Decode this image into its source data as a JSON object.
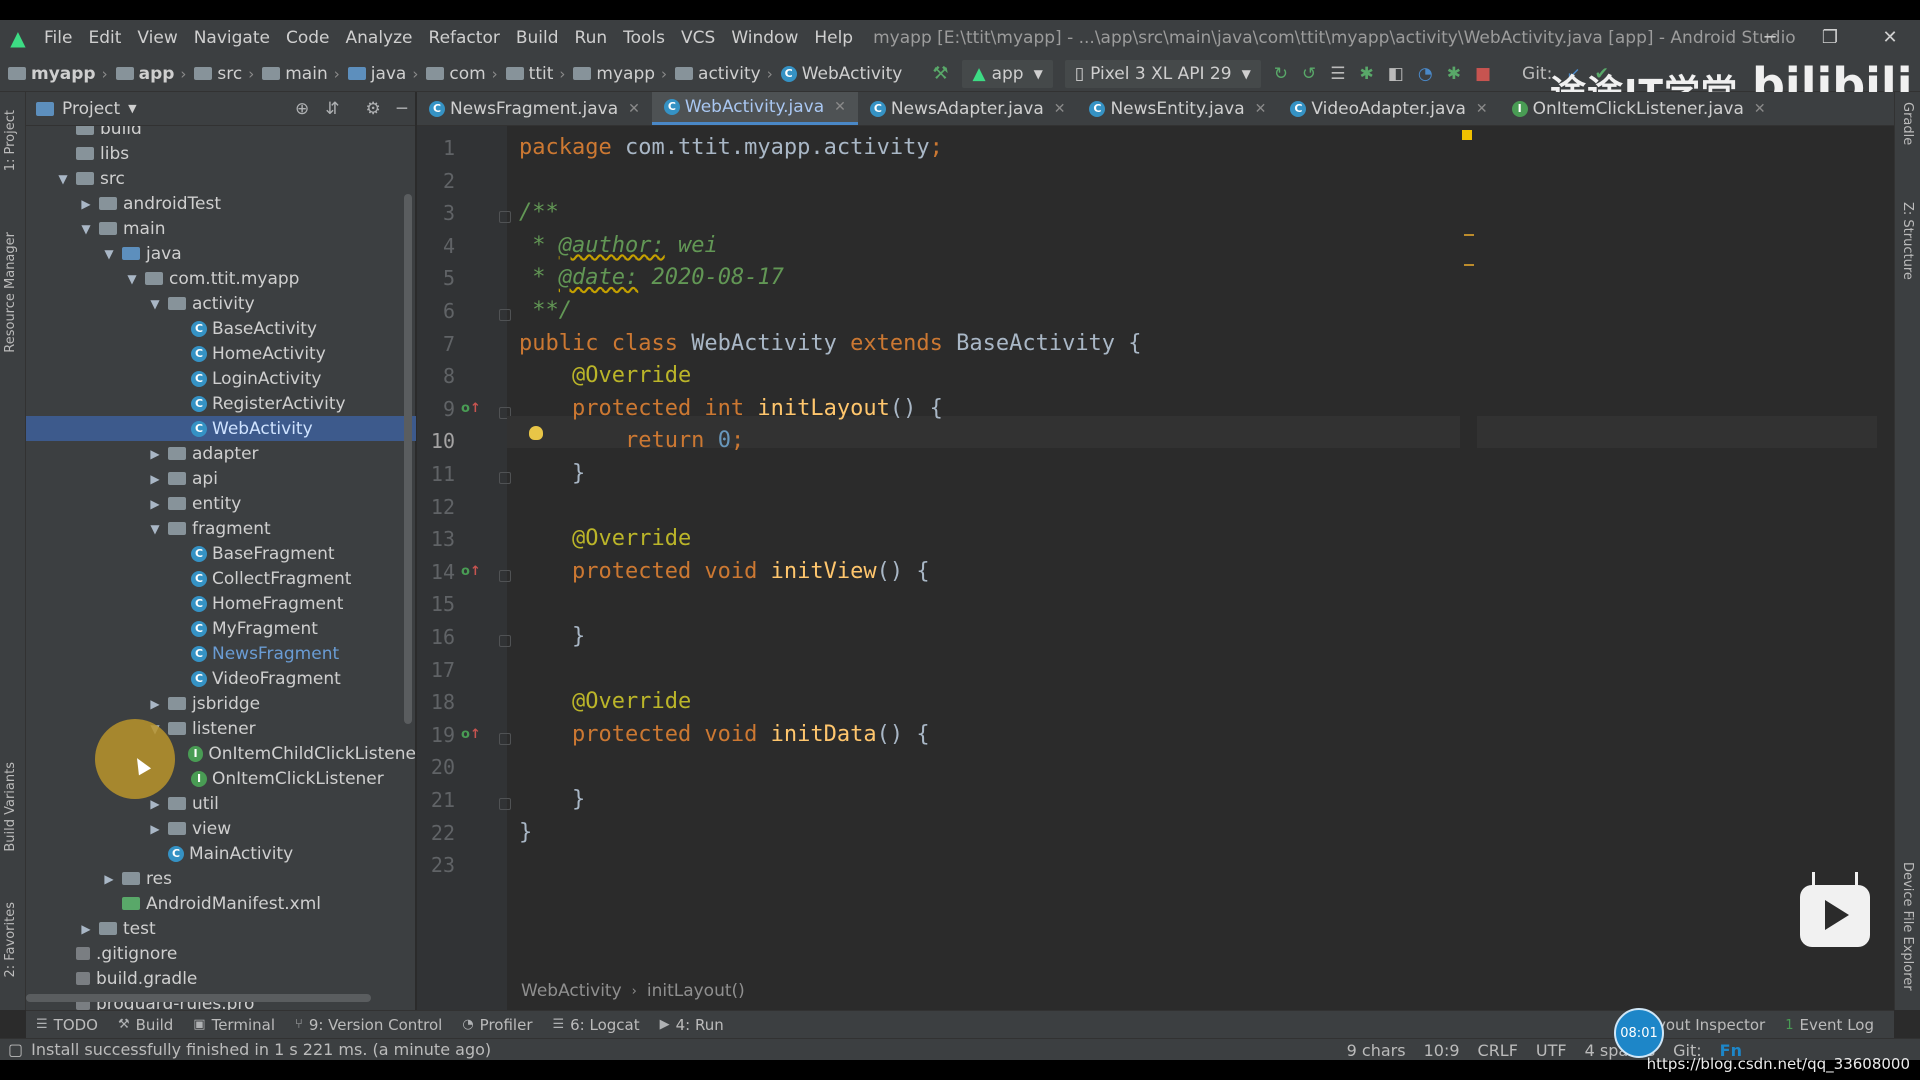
{
  "menubar": {
    "items": [
      "File",
      "Edit",
      "View",
      "Navigate",
      "Code",
      "Analyze",
      "Refactor",
      "Build",
      "Run",
      "Tools",
      "VCS",
      "Window",
      "Help"
    ],
    "title": "myapp [E:\\ttit\\myapp] - ...\\app\\src\\main\\java\\com\\ttit\\myapp\\activity\\WebActivity.java [app] - Android Studio"
  },
  "navbar": {
    "crumbs": [
      "myapp",
      "app",
      "src",
      "main",
      "java",
      "com",
      "ttit",
      "myapp",
      "activity",
      "WebActivity"
    ],
    "run_config": "app",
    "device": "Pixel 3 XL API 29",
    "git_label": "Git:"
  },
  "watermark": {
    "text1": "途途IT学堂",
    "text2": "bilibili"
  },
  "project_panel": {
    "title": "Project",
    "tree": [
      {
        "label": "build",
        "depth": 0,
        "type": "folder",
        "expand": ""
      },
      {
        "label": "libs",
        "depth": 0,
        "type": "folder",
        "expand": ""
      },
      {
        "label": "src",
        "depth": 0,
        "type": "folder",
        "expand": "▼"
      },
      {
        "label": "androidTest",
        "depth": 1,
        "type": "folder",
        "expand": "▶"
      },
      {
        "label": "main",
        "depth": 1,
        "type": "folder",
        "expand": "▼"
      },
      {
        "label": "java",
        "depth": 2,
        "type": "folder-blue",
        "expand": "▼"
      },
      {
        "label": "com.ttit.myapp",
        "depth": 3,
        "type": "package",
        "expand": "▼"
      },
      {
        "label": "activity",
        "depth": 4,
        "type": "package",
        "expand": "▼"
      },
      {
        "label": "BaseActivity",
        "depth": 5,
        "type": "class",
        "expand": ""
      },
      {
        "label": "HomeActivity",
        "depth": 5,
        "type": "class",
        "expand": ""
      },
      {
        "label": "LoginActivity",
        "depth": 5,
        "type": "class",
        "expand": ""
      },
      {
        "label": "RegisterActivity",
        "depth": 5,
        "type": "class",
        "expand": ""
      },
      {
        "label": "WebActivity",
        "depth": 5,
        "type": "class",
        "expand": "",
        "selected": true
      },
      {
        "label": "adapter",
        "depth": 4,
        "type": "package",
        "expand": "▶"
      },
      {
        "label": "api",
        "depth": 4,
        "type": "package",
        "expand": "▶"
      },
      {
        "label": "entity",
        "depth": 4,
        "type": "package",
        "expand": "▶"
      },
      {
        "label": "fragment",
        "depth": 4,
        "type": "package",
        "expand": "▼"
      },
      {
        "label": "BaseFragment",
        "depth": 5,
        "type": "class",
        "expand": ""
      },
      {
        "label": "CollectFragment",
        "depth": 5,
        "type": "class",
        "expand": ""
      },
      {
        "label": "HomeFragment",
        "depth": 5,
        "type": "class",
        "expand": ""
      },
      {
        "label": "MyFragment",
        "depth": 5,
        "type": "class",
        "expand": ""
      },
      {
        "label": "NewsFragment",
        "depth": 5,
        "type": "class",
        "expand": "",
        "new": true
      },
      {
        "label": "VideoFragment",
        "depth": 5,
        "type": "class",
        "expand": ""
      },
      {
        "label": "jsbridge",
        "depth": 4,
        "type": "package",
        "expand": "▶"
      },
      {
        "label": "listener",
        "depth": 4,
        "type": "package",
        "expand": "▼"
      },
      {
        "label": "OnItemChildClickListene",
        "depth": 5,
        "type": "interface",
        "expand": ""
      },
      {
        "label": "OnItemClickListener",
        "depth": 5,
        "type": "interface",
        "expand": ""
      },
      {
        "label": "util",
        "depth": 4,
        "type": "package",
        "expand": "▶"
      },
      {
        "label": "view",
        "depth": 4,
        "type": "package",
        "expand": "▶"
      },
      {
        "label": "MainActivity",
        "depth": 4,
        "type": "class",
        "expand": ""
      },
      {
        "label": "res",
        "depth": 2,
        "type": "folder",
        "expand": "▶"
      },
      {
        "label": "AndroidManifest.xml",
        "depth": 2,
        "type": "manifest",
        "expand": ""
      },
      {
        "label": "test",
        "depth": 1,
        "type": "folder",
        "expand": "▶"
      },
      {
        "label": ".gitignore",
        "depth": 0,
        "type": "file",
        "expand": ""
      },
      {
        "label": "build.gradle",
        "depth": 0,
        "type": "file",
        "expand": ""
      },
      {
        "label": "proguard-rules.pro",
        "depth": 0,
        "type": "file",
        "expand": ""
      }
    ]
  },
  "tabs": [
    {
      "label": "NewsFragment.java",
      "icon": "C",
      "active": false
    },
    {
      "label": "WebActivity.java",
      "icon": "C",
      "active": true
    },
    {
      "label": "NewsAdapter.java",
      "icon": "C",
      "active": false
    },
    {
      "label": "NewsEntity.java",
      "icon": "C",
      "active": false
    },
    {
      "label": "VideoAdapter.java",
      "icon": "C",
      "active": false
    },
    {
      "label": "OnItemClickListener.java",
      "icon": "I",
      "active": false
    }
  ],
  "editor": {
    "line_numbers": [
      "1",
      "2",
      "3",
      "4",
      "5",
      "6",
      "7",
      "8",
      "9",
      "10",
      "11",
      "12",
      "13",
      "14",
      "15",
      "16",
      "17",
      "18",
      "19",
      "20",
      "21",
      "22",
      "23"
    ],
    "current_line": "10",
    "breadcrumb": [
      "WebActivity",
      "initLayout()"
    ]
  },
  "code_lines": [
    [
      {
        "t": "package ",
        "c": "kw"
      },
      {
        "t": "com.ttit.myapp.activity",
        "c": "txt"
      },
      {
        "t": ";",
        "c": "kw"
      }
    ],
    [],
    [
      {
        "t": "/**",
        "c": "cm"
      }
    ],
    [
      {
        "t": " * ",
        "c": "cm"
      },
      {
        "t": "@author:",
        "c": "tag"
      },
      {
        "t": " wei",
        "c": "cm"
      }
    ],
    [
      {
        "t": " * ",
        "c": "cm"
      },
      {
        "t": "@date:",
        "c": "tag"
      },
      {
        "t": " 2020-08-17",
        "c": "cm"
      }
    ],
    [
      {
        "t": " **/",
        "c": "cm"
      }
    ],
    [
      {
        "t": "public class ",
        "c": "kw"
      },
      {
        "t": "WebActivity ",
        "c": "txt"
      },
      {
        "t": "extends ",
        "c": "kw"
      },
      {
        "t": "BaseActivity ",
        "c": "txt"
      },
      {
        "t": "{",
        "c": "txt"
      }
    ],
    [
      {
        "t": "    @Override",
        "c": "ann"
      }
    ],
    [
      {
        "t": "    protected int ",
        "c": "kw"
      },
      {
        "t": "initLayout",
        "c": "fn"
      },
      {
        "t": "() {",
        "c": "txt"
      }
    ],
    [
      {
        "t": "        return ",
        "c": "kw"
      },
      {
        "t": "0",
        "c": "num"
      },
      {
        "t": ";",
        "c": "kw"
      }
    ],
    [
      {
        "t": "    }",
        "c": "txt"
      }
    ],
    [],
    [
      {
        "t": "    @Override",
        "c": "ann"
      }
    ],
    [
      {
        "t": "    protected void ",
        "c": "kw"
      },
      {
        "t": "initView",
        "c": "fn"
      },
      {
        "t": "() {",
        "c": "txt"
      }
    ],
    [],
    [
      {
        "t": "    }",
        "c": "txt"
      }
    ],
    [],
    [
      {
        "t": "    @Override",
        "c": "ann"
      }
    ],
    [
      {
        "t": "    protected void ",
        "c": "kw"
      },
      {
        "t": "initData",
        "c": "fn"
      },
      {
        "t": "() {",
        "c": "txt"
      }
    ],
    [],
    [
      {
        "t": "    }",
        "c": "txt"
      }
    ],
    [
      {
        "t": "}",
        "c": "txt"
      }
    ],
    []
  ],
  "toolwindows": [
    {
      "label": "TODO",
      "icon": "☰"
    },
    {
      "label": "Build",
      "icon": "⚒"
    },
    {
      "label": "Terminal",
      "icon": "▣"
    },
    {
      "label": "9: Version Control",
      "icon": "⑂"
    },
    {
      "label": "Profiler",
      "icon": "◔"
    },
    {
      "label": "6: Logcat",
      "icon": "☰"
    },
    {
      "label": "4: Run",
      "icon": "▶"
    }
  ],
  "toolwindows_right": [
    {
      "label": "ayout Inspector",
      "icon": ""
    },
    {
      "label": "Event Log",
      "icon": "1"
    }
  ],
  "status": {
    "message": "Install successfully finished in 1 s 221 ms. (a minute ago)",
    "chars": "9 chars",
    "pos": "10:9",
    "line_sep": "CRLF",
    "encoding": "UTF",
    "indent": "4 spaces",
    "git": "Git:",
    "clock": "08:01",
    "fn": "Fn"
  },
  "strips": {
    "left": [
      "1: Project",
      "Resource Manager",
      "Build Variants",
      "2: Favorites"
    ],
    "right": [
      "Gradle",
      "Z: Structure",
      "Device File Explorer"
    ]
  },
  "url_watermark": "https://blog.csdn.net/qq_33608000"
}
